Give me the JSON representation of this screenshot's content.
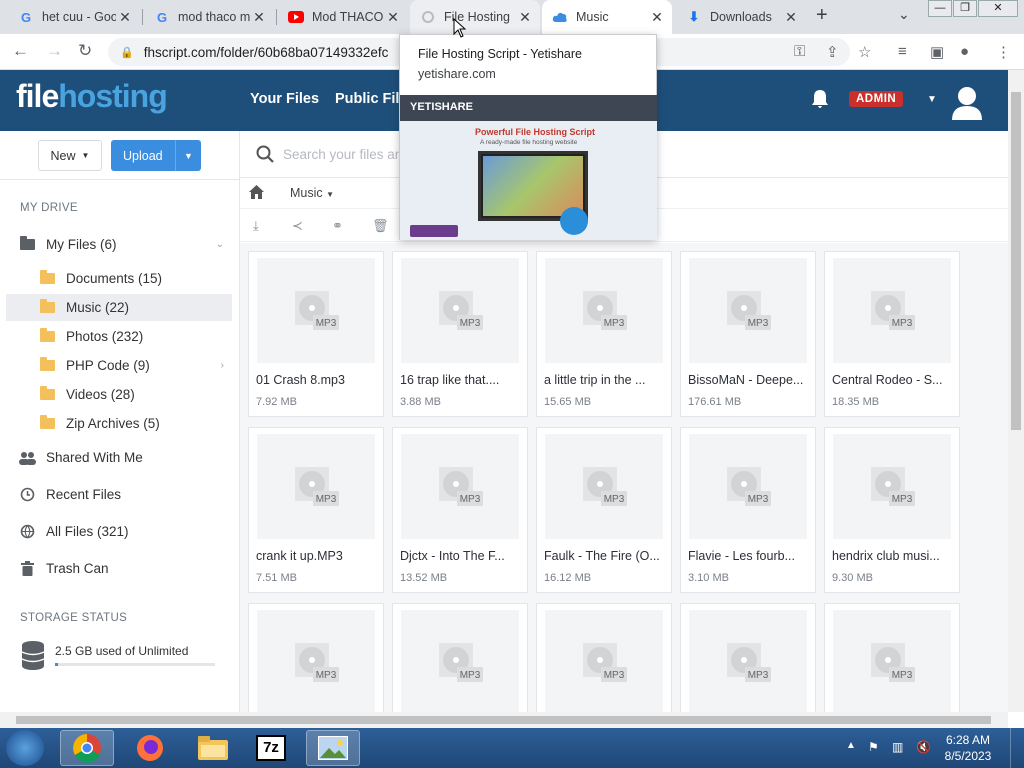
{
  "browser": {
    "tabs": [
      {
        "title": "het cuu - Google",
        "icon": "google-icon"
      },
      {
        "title": "mod thaco mu",
        "icon": "google-icon"
      },
      {
        "title": "Mod THACO",
        "icon": "youtube-icon"
      },
      {
        "title": "File Hosting",
        "icon": "loading-icon"
      },
      {
        "title": "Music",
        "icon": "cloud-icon"
      },
      {
        "title": "Downloads",
        "icon": "download-icon"
      }
    ],
    "new_tab": "+",
    "url": "fhscript.com/folder/60b68ba07149332efc",
    "tooltip": {
      "title": "File Hosting Script - Yetishare",
      "domain": "yetishare.com",
      "preview_logo": "YETISHARE",
      "preview_heading": "Powerful File Hosting Script",
      "preview_sub": "A ready-made file hosting website"
    }
  },
  "site": {
    "logo_part1": "file",
    "logo_part2": "hosting",
    "nav": [
      "Your Files",
      "Public Files"
    ],
    "admin_badge": "ADMIN",
    "colors": {
      "header": "#1e4f7a",
      "accent": "#3b8de0",
      "admin": "#c9302c"
    }
  },
  "sidebar": {
    "new_label": "New",
    "upload_label": "Upload",
    "section_drive": "MY DRIVE",
    "my_files": "My Files (6)",
    "folders": [
      "Documents (15)",
      "Music (22)",
      "Photos (232)",
      "PHP Code (9)",
      "Videos (28)",
      "Zip Archives (5)"
    ],
    "shared": "Shared With Me",
    "recent": "Recent Files",
    "all_files": "All Files (321)",
    "trash": "Trash Can",
    "section_storage": "STORAGE STATUS",
    "storage_text": "2.5 GB used of Unlimited"
  },
  "main": {
    "search_placeholder": "Search your files and",
    "breadcrumb_folder": "Music",
    "thumb_label": "MP3",
    "files": [
      {
        "name": "01 Crash 8.mp3",
        "size": "7.92 MB"
      },
      {
        "name": "16 trap like that....",
        "size": "3.88 MB"
      },
      {
        "name": "a little trip in the ...",
        "size": "15.65 MB"
      },
      {
        "name": "BissoMaN - Deepe...",
        "size": "176.61 MB"
      },
      {
        "name": "Central Rodeo - S...",
        "size": "18.35 MB"
      },
      {
        "name": "crank it up.MP3",
        "size": "7.51 MB"
      },
      {
        "name": "Djctx - Into The F...",
        "size": "13.52 MB"
      },
      {
        "name": "Faulk - The Fire (O...",
        "size": "16.12 MB"
      },
      {
        "name": "Flavie - Les fourb...",
        "size": "3.10 MB"
      },
      {
        "name": "hendrix club musi...",
        "size": "9.30 MB"
      },
      {
        "name": "",
        "size": ""
      },
      {
        "name": "",
        "size": ""
      },
      {
        "name": "",
        "size": ""
      },
      {
        "name": "",
        "size": ""
      },
      {
        "name": "",
        "size": ""
      }
    ]
  },
  "taskbar": {
    "apps": [
      "chrome-icon",
      "firefox-icon",
      "explorer-icon",
      "7zip-icon",
      "photo-viewer-icon"
    ],
    "app_7z": "7z",
    "time": "6:28 AM",
    "date": "8/5/2023"
  }
}
